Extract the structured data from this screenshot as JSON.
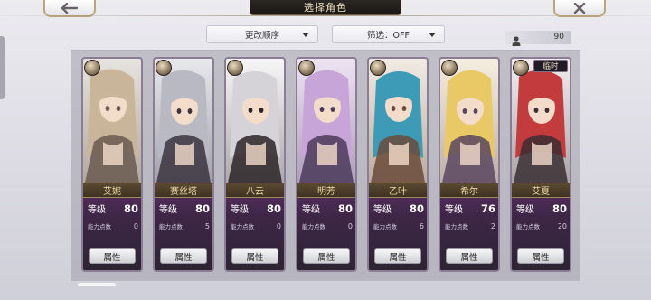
{
  "header": {
    "title": "选择角色"
  },
  "controls": {
    "sort_label": "更改顺序",
    "filter_label": "筛选：OFF",
    "roster_count": "90"
  },
  "icons": {
    "back": "back-arrow-icon",
    "close": "close-x-icon",
    "count": "person-icon",
    "sort_arrow": "dropdown-triangle-icon",
    "filter_arrow": "dropdown-triangle-icon"
  },
  "labels": {
    "level": "等级",
    "points": "能力点数",
    "attr_button": "属性",
    "temp": "临时"
  },
  "characters": [
    {
      "name": "艾妮",
      "level": "80",
      "points": "0",
      "class_icon": "crescent-class-icon",
      "palette": [
        "#d9d3cb",
        "#c9b69a",
        "#6a5a50"
      ]
    },
    {
      "name": "赛丝塔",
      "level": "80",
      "points": "5",
      "class_icon": "sword-class-icon",
      "palette": [
        "#dcdde2",
        "#b8b9c2",
        "#3a3440"
      ]
    },
    {
      "name": "八云",
      "level": "80",
      "points": "0",
      "class_icon": "crescent-class-icon",
      "palette": [
        "#f2f1f3",
        "#d6d3d8",
        "#2b2527"
      ]
    },
    {
      "name": "明芳",
      "level": "80",
      "points": "0",
      "class_icon": "crescent-class-icon",
      "palette": [
        "#e4d4ec",
        "#c7a5d8",
        "#4c3a5a"
      ]
    },
    {
      "name": "乙叶",
      "level": "80",
      "points": "6",
      "class_icon": "sword-class-icon",
      "palette": [
        "#e8e0d4",
        "#3e9bb8",
        "#6a4a3a"
      ]
    },
    {
      "name": "希尔",
      "level": "76",
      "points": "2",
      "class_icon": "sword-class-icon",
      "palette": [
        "#f1e6cf",
        "#e9c966",
        "#5a4660"
      ]
    },
    {
      "name": "艾夏",
      "level": "80",
      "points": "20",
      "class_icon": "crescent-class-icon",
      "palette": [
        "#e9e3e4",
        "#c43b3e",
        "#3a2f33"
      ],
      "temp": true
    }
  ]
}
